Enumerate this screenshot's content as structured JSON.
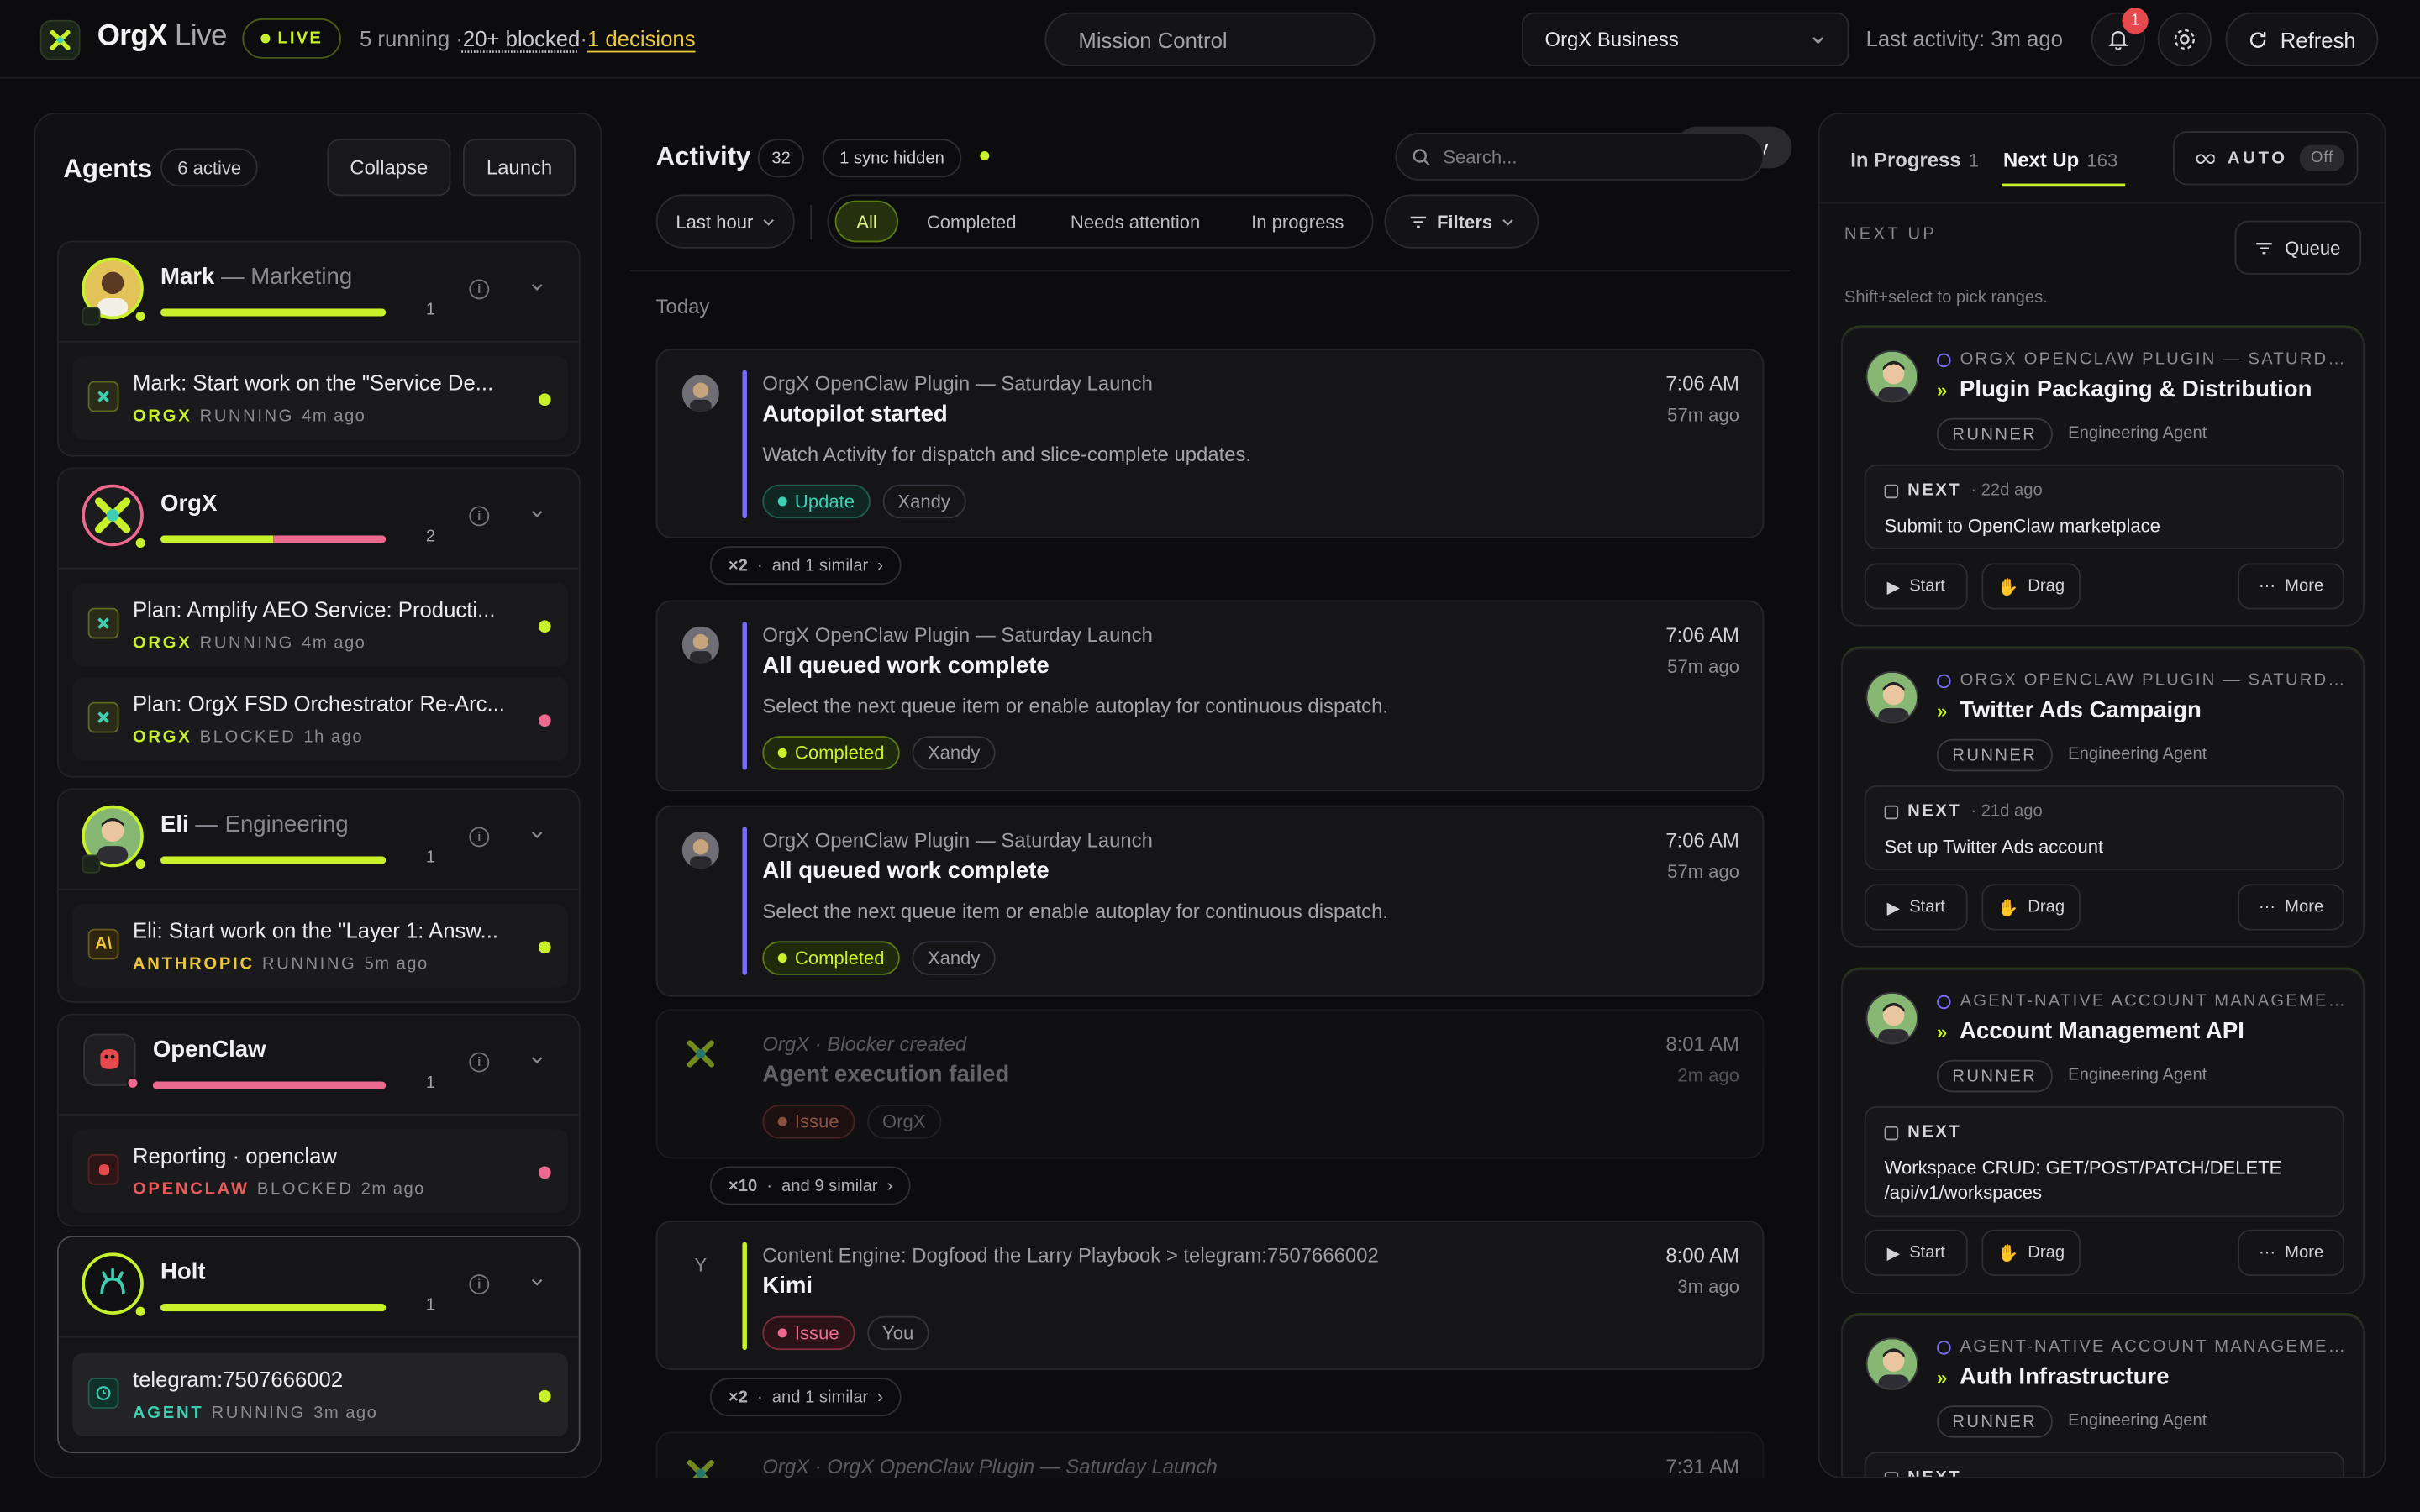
{
  "header": {
    "brand": "OrgX",
    "brand_sub": "Live",
    "live_label": "LIVE",
    "running": "5 running",
    "blocked": "20+ blocked",
    "decisions": "1 decisions",
    "sep": "·",
    "tabs": {
      "activity": "Activity",
      "mission": "Mission Control"
    },
    "workspace": "OrgX Business",
    "last_activity": "Last activity: 3m ago",
    "notif_count": "1",
    "refresh": "Refresh"
  },
  "agents": {
    "title": "Agents",
    "count": "6 active",
    "collapse": "Collapse",
    "launch": "Launch",
    "groups": [
      {
        "name": "Mark",
        "role": "— Marketing",
        "count": "1",
        "tasks": [
          {
            "title": "Mark: Start work on the \"Service De...",
            "provider": "ORGX",
            "status": "RUNNING",
            "ago": "4m ago"
          }
        ]
      },
      {
        "name": "OrgX",
        "role": "",
        "count": "2",
        "tasks": [
          {
            "title": "Plan: Amplify AEO Service: Producti...",
            "provider": "ORGX",
            "status": "RUNNING",
            "ago": "4m ago"
          },
          {
            "title": "Plan: OrgX FSD Orchestrator Re-Arc...",
            "provider": "ORGX",
            "status": "BLOCKED",
            "ago": "1h ago"
          }
        ]
      },
      {
        "name": "Eli",
        "role": "— Engineering",
        "count": "1",
        "tasks": [
          {
            "title": "Eli: Start work on the \"Layer 1: Answ...",
            "provider": "ANTHROPIC",
            "status": "RUNNING",
            "ago": "5m ago"
          }
        ]
      },
      {
        "name": "OpenClaw",
        "role": "",
        "count": "1",
        "tasks": [
          {
            "title": "Reporting · openclaw",
            "provider": "OPENCLAW",
            "status": "BLOCKED",
            "ago": "2m ago"
          }
        ]
      },
      {
        "name": "Holt",
        "role": "",
        "count": "1",
        "tasks": [
          {
            "title": "telegram:7507666002",
            "provider": "AGENT",
            "status": "RUNNING",
            "ago": "3m ago"
          }
        ]
      }
    ]
  },
  "activity": {
    "title": "Activity",
    "count": "32",
    "sync_hidden": "1 sync hidden",
    "search_placeholder": "Search...",
    "range": "Last hour",
    "filters": [
      "All",
      "Completed",
      "Needs attention",
      "In progress"
    ],
    "filters_btn": "Filters",
    "today": "Today",
    "cards": [
      {
        "project": "OrgX OpenClaw Plugin — Saturday Launch",
        "title": "Autopilot started",
        "desc": "Watch Activity for dispatch and slice-complete updates.",
        "time": "7:06 AM",
        "ago": "57m ago",
        "tag": "Update",
        "who": "Xandy"
      },
      {
        "project": "OrgX OpenClaw Plugin — Saturday Launch",
        "title": "All queued work complete",
        "desc": "Select the next queue item or enable autoplay for continuous dispatch.",
        "time": "7:06 AM",
        "ago": "57m ago",
        "tag": "Completed",
        "who": "Xandy"
      },
      {
        "project": "OrgX OpenClaw Plugin — Saturday Launch",
        "title": "All queued work complete",
        "desc": "Select the next queue item or enable autoplay for continuous dispatch.",
        "time": "7:06 AM",
        "ago": "57m ago",
        "tag": "Completed",
        "who": "Xandy"
      },
      {
        "project": "OrgX · Blocker created",
        "title": "Agent execution failed",
        "desc": "",
        "time": "8:01 AM",
        "ago": "2m ago",
        "tag": "Issue",
        "who": "OrgX"
      },
      {
        "project": "Content Engine: Dogfood the Larry Playbook > telegram:7507666002",
        "title": "Kimi",
        "desc": "",
        "time": "8:00 AM",
        "ago": "3m ago",
        "tag": "Issue",
        "who": "You",
        "initial": "Y"
      },
      {
        "project": "OrgX · OrgX OpenClaw Plugin — Saturday Launch",
        "title": "",
        "desc": "",
        "time": "7:31 AM",
        "ago": "",
        "tag": "",
        "who": ""
      }
    ],
    "similar": [
      {
        "mult": "×2",
        "text": "and 1 similar"
      },
      {
        "mult": "×10",
        "text": "and 9 similar"
      },
      {
        "mult": "×2",
        "text": "and 1 similar"
      }
    ]
  },
  "queue": {
    "tab_progress": "In Progress",
    "tab_progress_count": "1",
    "tab_next": "Next Up",
    "tab_next_count": "163",
    "auto": "AUTO",
    "auto_state": "Off",
    "next_up": "NEXT UP",
    "queue_btn": "Queue",
    "hint": "Shift+select to pick ranges.",
    "items": [
      {
        "project": "ORGX OPENCLAW PLUGIN — SATURDAY LAUNCH",
        "title": "Plugin Packaging & Distribution",
        "runner": "RUNNER",
        "agent": "Engineering Agent",
        "next_label": "NEXT",
        "next_ago": "· 22d ago",
        "next_text": "Submit to OpenClaw marketplace"
      },
      {
        "project": "ORGX OPENCLAW PLUGIN — SATURDAY LAUNCH",
        "title": "Twitter Ads Campaign",
        "runner": "RUNNER",
        "agent": "Engineering Agent",
        "next_label": "NEXT",
        "next_ago": "· 21d ago",
        "next_text": "Set up Twitter Ads account"
      },
      {
        "project": "AGENT-NATIVE ACCOUNT MANAGEMENT",
        "title": "Account Management API",
        "runner": "RUNNER",
        "agent": "Engineering Agent",
        "next_label": "NEXT",
        "next_ago": "",
        "next_text": "Workspace CRUD: GET/POST/PATCH/DELETE /api/v1/workspaces"
      },
      {
        "project": "AGENT-NATIVE ACCOUNT MANAGEMENT",
        "title": "Auth Infrastructure",
        "runner": "RUNNER",
        "agent": "Engineering Agent",
        "next_label": "NEXT",
        "next_ago": "",
        "next_text": ""
      }
    ],
    "start": "Start",
    "drag": "Drag",
    "more": "More"
  },
  "colors": {
    "accent": "#c8f02b",
    "blocked": "#ec6a8f",
    "running": "#c8f02b",
    "anthropic": "#e8c73d",
    "issue": "#ec6a8f",
    "update": "#3ecfb2"
  }
}
